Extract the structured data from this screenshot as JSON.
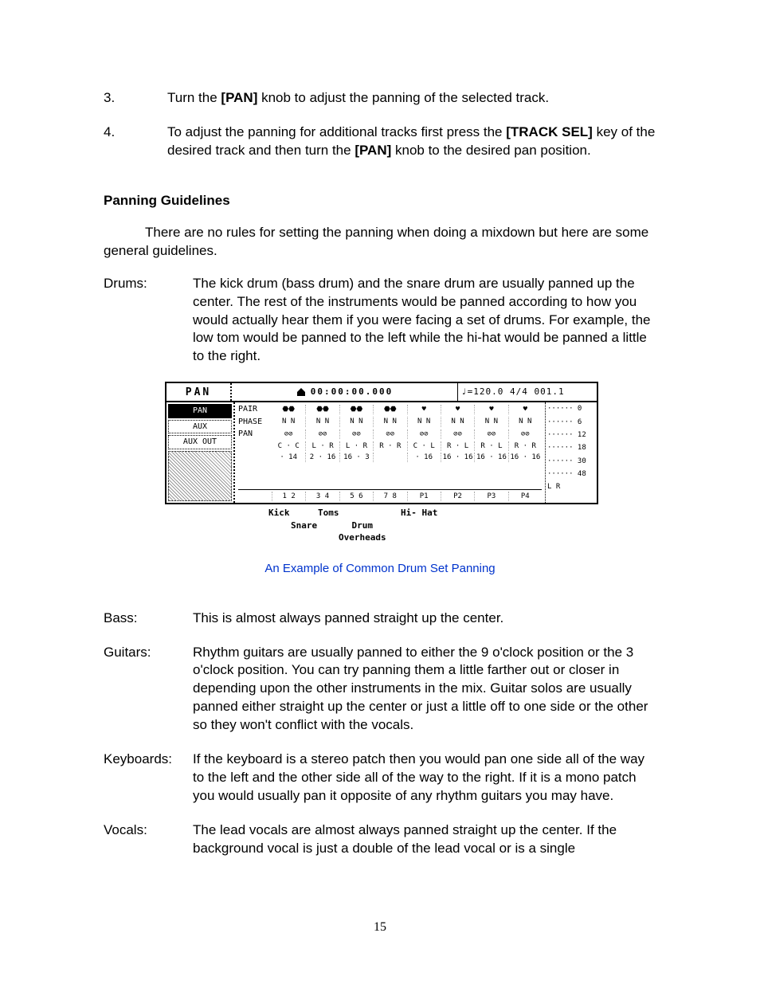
{
  "steps": [
    {
      "num": "3.",
      "pre": "Turn the ",
      "kw1": "[PAN]",
      "post": " knob to adjust the panning of the selected track."
    },
    {
      "num": "4.",
      "pre": "To adjust the panning for additional tracks first press the ",
      "kw1": "[TRACK SEL]",
      "mid": " key of the desired track and then turn the ",
      "kw2": "[PAN]",
      "post": " knob to the desired pan position."
    }
  ],
  "section_title": "Panning Guidelines",
  "intro": "There are no rules for setting the panning when doing a mixdown but here are some general guidelines.",
  "defs": [
    {
      "term": "Drums:",
      "desc": "The kick drum (bass drum) and the snare drum are usually panned up the center.  The rest of the instruments would be panned according to how you would actually hear them if you were facing a set of drums.  For example, the low tom would be panned to the left while the hi-hat would be panned a little to the right."
    }
  ],
  "defs2": [
    {
      "term": "Bass:",
      "desc": "This is almost always panned straight up the center."
    },
    {
      "term": "Guitars:",
      "desc": "Rhythm guitars are usually panned to either the 9 o'clock position or the 3 o'clock position.  You can try panning them a little farther out or closer in depending upon the other instruments in the mix.  Guitar solos are usually panned either straight up the center or just a little off to one side or the other so they won't conflict with the vocals."
    },
    {
      "term": "Keyboards:",
      "desc": "If the keyboard is a stereo patch then you would pan one side all of the way to the left and the other side all of the way to the right.  If it is a mono patch you would usually pan it opposite of any rhythm guitars you may have."
    },
    {
      "term": "Vocals:",
      "desc": "The lead vocals are almost always panned straight up the center.  If the background vocal is just a double of the lead vocal or is a single"
    }
  ],
  "figure": {
    "top_title": "PAN",
    "timecode": "00:00:00.000",
    "tempo": "♩=120.0 4/4 001.1",
    "menu": [
      "PAN",
      "AUX",
      "AUX OUT"
    ],
    "rows": {
      "pair": {
        "label": "PAIR",
        "cells": [
          "⬣⬣",
          "⬣⬣",
          "⬣⬣",
          "⬣⬣",
          "♥",
          "♥",
          "♥",
          "♥"
        ]
      },
      "phase": {
        "label": "PHASE",
        "cells": [
          "N N",
          "N N",
          "N N",
          "N N",
          "N N",
          "N N",
          "N N",
          "N N"
        ]
      },
      "pan": {
        "label": "PAN",
        "cells": [
          "⊘⊘",
          "⊘⊘",
          "⊘⊘",
          "⊘⊘",
          "⊘⊘",
          "⊘⊘",
          "⊘⊘",
          "⊘⊘"
        ]
      },
      "lr": {
        "label": "",
        "cells": [
          "C · C",
          "L · R",
          "L · R",
          "R · R",
          "C · L",
          "R · L",
          "R · L",
          "R · R"
        ]
      },
      "lvl": {
        "label": "",
        "cells": [
          "· 14",
          "2 · 16",
          "16 · 3",
          "",
          "· 16",
          "16 · 16",
          "16 · 16",
          "16 · 16"
        ]
      }
    },
    "tracks": [
      "1   2",
      "3   4",
      "5   6",
      "7   8",
      "P1",
      "P2",
      "P3",
      "P4"
    ],
    "meter": [
      "······ 0",
      "······ 6",
      "······ 12",
      "······ 18",
      "······ 30",
      "······ 48",
      "L R"
    ],
    "callouts": {
      "kick": "Kick",
      "snare": "Snare",
      "toms": "Toms",
      "overheads": "Drum\nOverheads",
      "hihat": "Hi- Hat"
    }
  },
  "caption": "An Example of Common Drum Set Panning",
  "page_number": "15"
}
